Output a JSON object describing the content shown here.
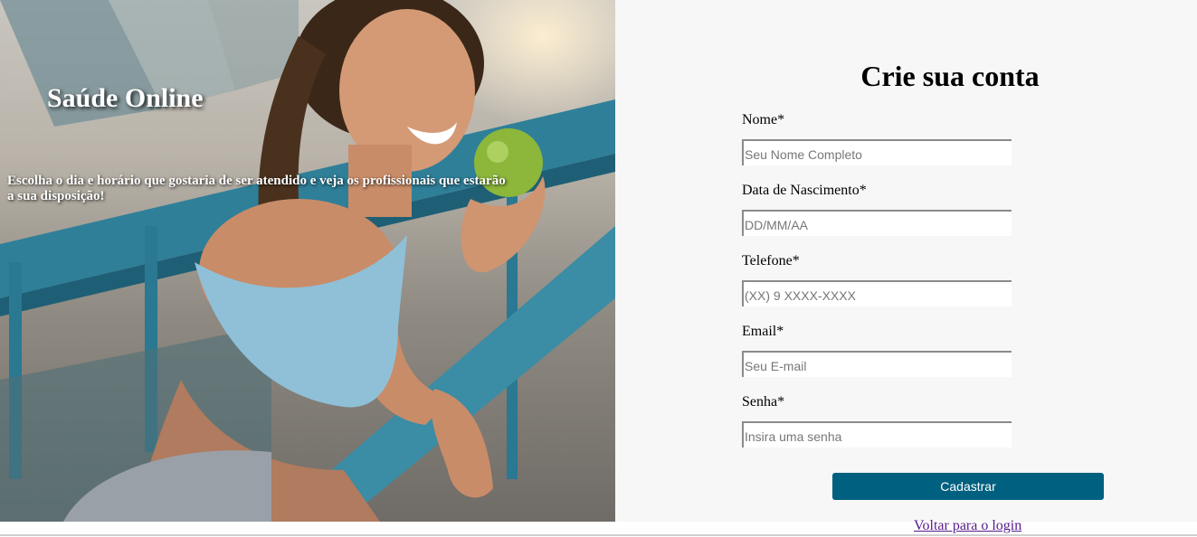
{
  "hero": {
    "title": "Saúde Online",
    "subtitle": "Escolha o dia e horário que gostaria de ser atendido e veja os profissionais que estarão a sua disposição!"
  },
  "form": {
    "title": "Crie sua conta",
    "fields": [
      {
        "label": "Nome*",
        "placeholder": "Seu Nome Completo",
        "value": ""
      },
      {
        "label": "Data de Nascimento*",
        "placeholder": "DD/MM/AA",
        "value": ""
      },
      {
        "label": "Telefone*",
        "placeholder": "(XX) 9 XXXX-XXXX",
        "value": ""
      },
      {
        "label": "Email*",
        "placeholder": "Seu E-mail",
        "value": ""
      },
      {
        "label": "Senha*",
        "placeholder": "Insira uma senha",
        "value": ""
      }
    ],
    "submit_label": "Cadastrar",
    "back_link": "Voltar para o login"
  },
  "colors": {
    "primary_button": "#00607f",
    "panel_background": "#f7f7f7",
    "link_visited": "#551a8b"
  }
}
